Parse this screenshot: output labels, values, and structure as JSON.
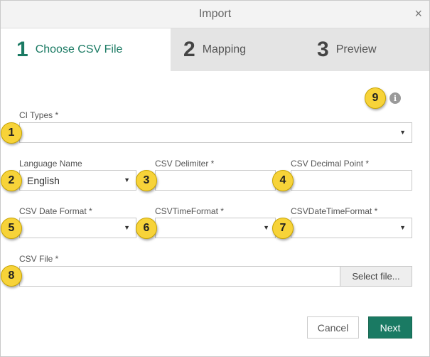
{
  "dialog": {
    "title": "Import",
    "close_glyph": "×"
  },
  "tabs": [
    {
      "number": "1",
      "label": "Choose CSV File",
      "active": true
    },
    {
      "number": "2",
      "label": "Mapping",
      "active": false
    },
    {
      "number": "3",
      "label": "Preview",
      "active": false
    }
  ],
  "info": {
    "glyph": "i",
    "icon": "info-icon"
  },
  "form": {
    "ci_types": {
      "label": "CI Types *",
      "value": ""
    },
    "language": {
      "label": "Language Name",
      "value": "English"
    },
    "csv_delimiter": {
      "label": "CSV Delimiter *",
      "value": ""
    },
    "csv_decimal_point": {
      "label": "CSV Decimal Point *",
      "value": ""
    },
    "csv_date_format": {
      "label": "CSV Date Format *",
      "value": ""
    },
    "csv_time_format": {
      "label": "CSVTimeFormat *",
      "value": ""
    },
    "csv_datetime_format": {
      "label": "CSVDateTimeFormat *",
      "value": ""
    },
    "csv_file": {
      "label": "CSV File *",
      "value": "",
      "button_label": "Select file..."
    }
  },
  "dropdown_caret": "▼",
  "buttons": {
    "cancel": "Cancel",
    "next": "Next"
  },
  "badges": [
    "1",
    "2",
    "3",
    "4",
    "5",
    "6",
    "7",
    "8",
    "9"
  ],
  "colors": {
    "accent": "#1a7a63",
    "badge": "#f7d339"
  }
}
